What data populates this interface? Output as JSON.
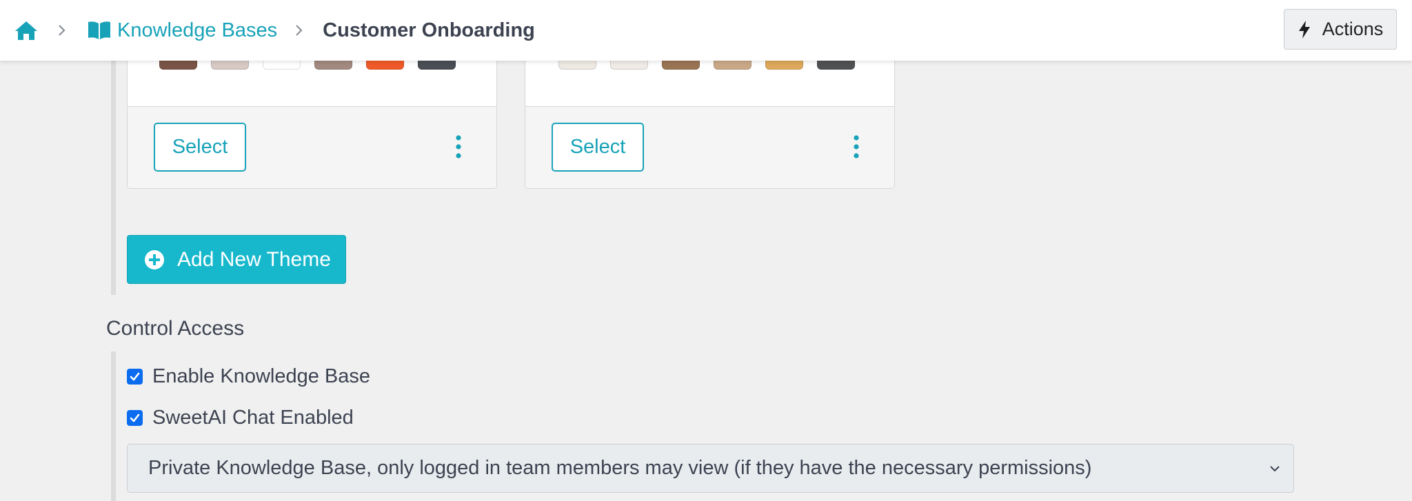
{
  "breadcrumb": {
    "home_icon": "home-icon",
    "items": [
      {
        "label": "Knowledge Bases",
        "icon": "book-icon"
      },
      {
        "label": "Customer Onboarding"
      }
    ]
  },
  "header": {
    "actions_label": "Actions",
    "actions_icon": "bolt-icon"
  },
  "themes": [
    {
      "select_label": "Select",
      "menu_icon": "kebab-icon",
      "swatches": [
        "#7a5547",
        "#d8c9c4",
        "#ffffff",
        "#a38a80",
        "#f05a28",
        "#4a4e55"
      ]
    },
    {
      "select_label": "Select",
      "menu_icon": "kebab-icon",
      "swatches": [
        "#efe9e4",
        "#f0ebe6",
        "#9a7554",
        "#c9a888",
        "#dea95c",
        "#505153"
      ]
    }
  ],
  "add_theme_label": "Add New Theme",
  "control_access": {
    "title": "Control Access",
    "options": [
      {
        "label": "Enable Knowledge Base",
        "checked": true
      },
      {
        "label": "SweetAI Chat Enabled",
        "checked": true
      }
    ],
    "privacy_selected": "Private Knowledge Base, only logged in team members may view (if they have the necessary permissions)"
  },
  "colors": {
    "accent": "#17a2b8",
    "button_fill": "#17b8cc",
    "checkbox": "#0b6cf0",
    "background": "#f0f0f0"
  }
}
